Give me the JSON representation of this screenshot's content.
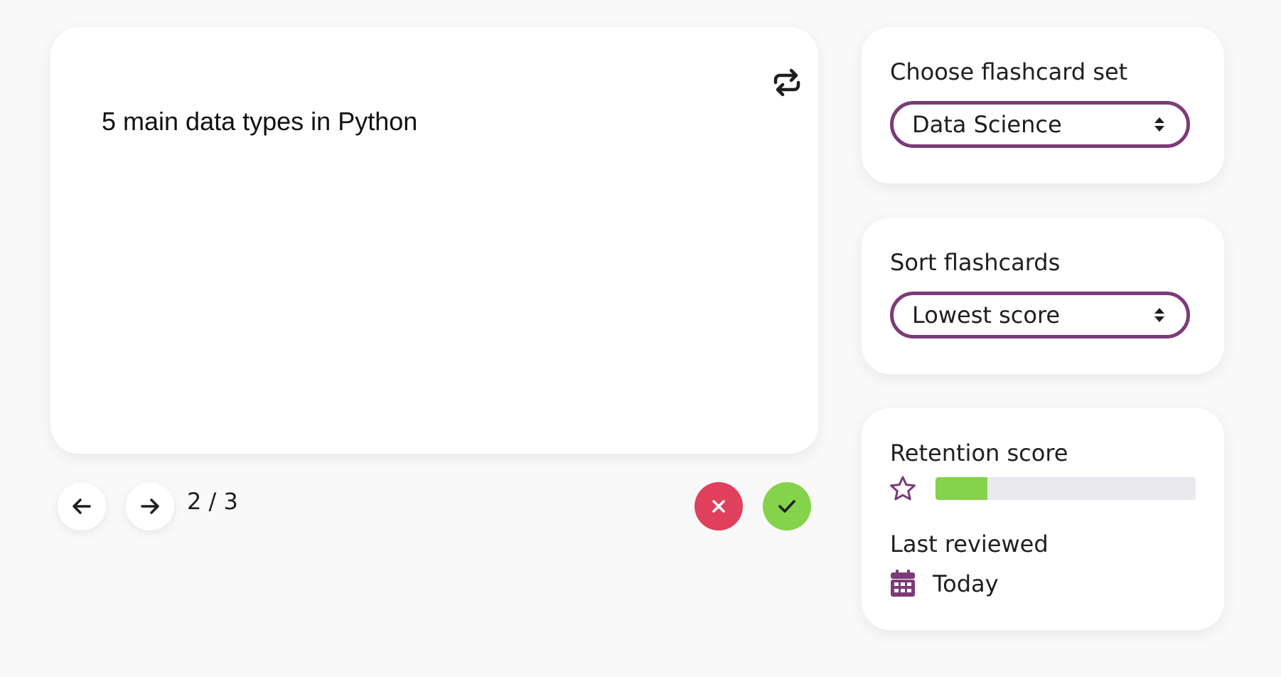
{
  "flashcard": {
    "text": "5 main data types in Python"
  },
  "navigation": {
    "counter": "2 / 3"
  },
  "set_panel": {
    "label": "Choose flashcard set",
    "selected": "Data Science"
  },
  "sort_panel": {
    "label": "Sort flashcards",
    "selected": "Lowest score"
  },
  "stats_panel": {
    "retention_label": "Retention score",
    "retention_fraction": 0.2,
    "last_reviewed_label": "Last reviewed",
    "last_reviewed_value": "Today"
  },
  "colors": {
    "accent": "#7b3b78",
    "wrong": "#e0405b",
    "correct": "#84d34a",
    "track": "#e9e9ee"
  },
  "icons": {
    "flip": "repeat-icon",
    "prev": "arrow-left-icon",
    "next": "arrow-right-icon",
    "wrong": "x-icon",
    "correct": "check-icon",
    "retention": "star-icon",
    "last_reviewed": "calendar-icon",
    "select": "sort-arrows-icon"
  }
}
